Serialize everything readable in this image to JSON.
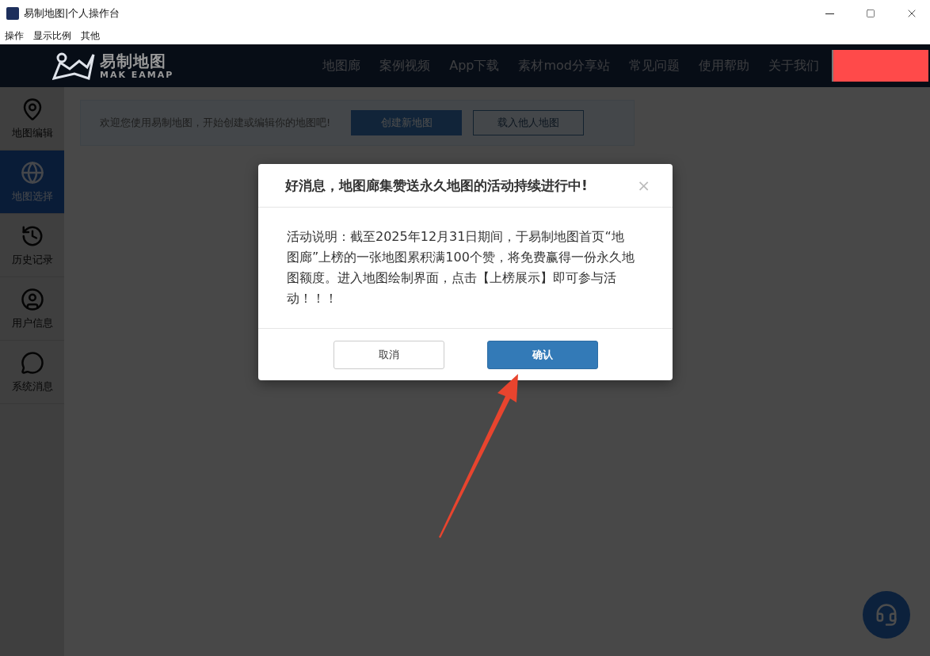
{
  "window": {
    "title": "易制地图|个人操作台"
  },
  "menu": [
    "操作",
    "显示比例",
    "其他"
  ],
  "header": {
    "logo_text": "易制地图",
    "logo_subtext": "MAK EAMAP",
    "nav": [
      "地图廊",
      "案例视频",
      "App下载",
      "素材mod分享站",
      "常见问题",
      "使用帮助",
      "关于我们"
    ]
  },
  "sidebar": {
    "items": [
      {
        "label": "地图编辑",
        "selected": false
      },
      {
        "label": "地图选择",
        "selected": true
      },
      {
        "label": "历史记录",
        "selected": false
      },
      {
        "label": "用户信息",
        "selected": false
      },
      {
        "label": "系统消息",
        "selected": false
      }
    ]
  },
  "welcome": {
    "text": "欢迎您使用易制地图，开始创建或编辑你的地图吧!",
    "buttons": [
      {
        "label": "创建新地图",
        "kind": "primary"
      },
      {
        "label": "载入他人地图",
        "kind": "outline"
      }
    ]
  },
  "dialog": {
    "title": "好消息，地图廊集赞送永久地图的活动持续进行中!",
    "close": "×",
    "body": "活动说明：截至2025年12月31日期间，于易制地图首页“地图廊”上榜的一张地图累积满100个赞，将免费赢得一份永久地图额度。进入地图绘制界面，点击【上榜展示】即可参与活动！！！",
    "buttons": [
      {
        "label": "取消",
        "kind": "default"
      },
      {
        "label": "确认",
        "kind": "primary"
      }
    ]
  }
}
